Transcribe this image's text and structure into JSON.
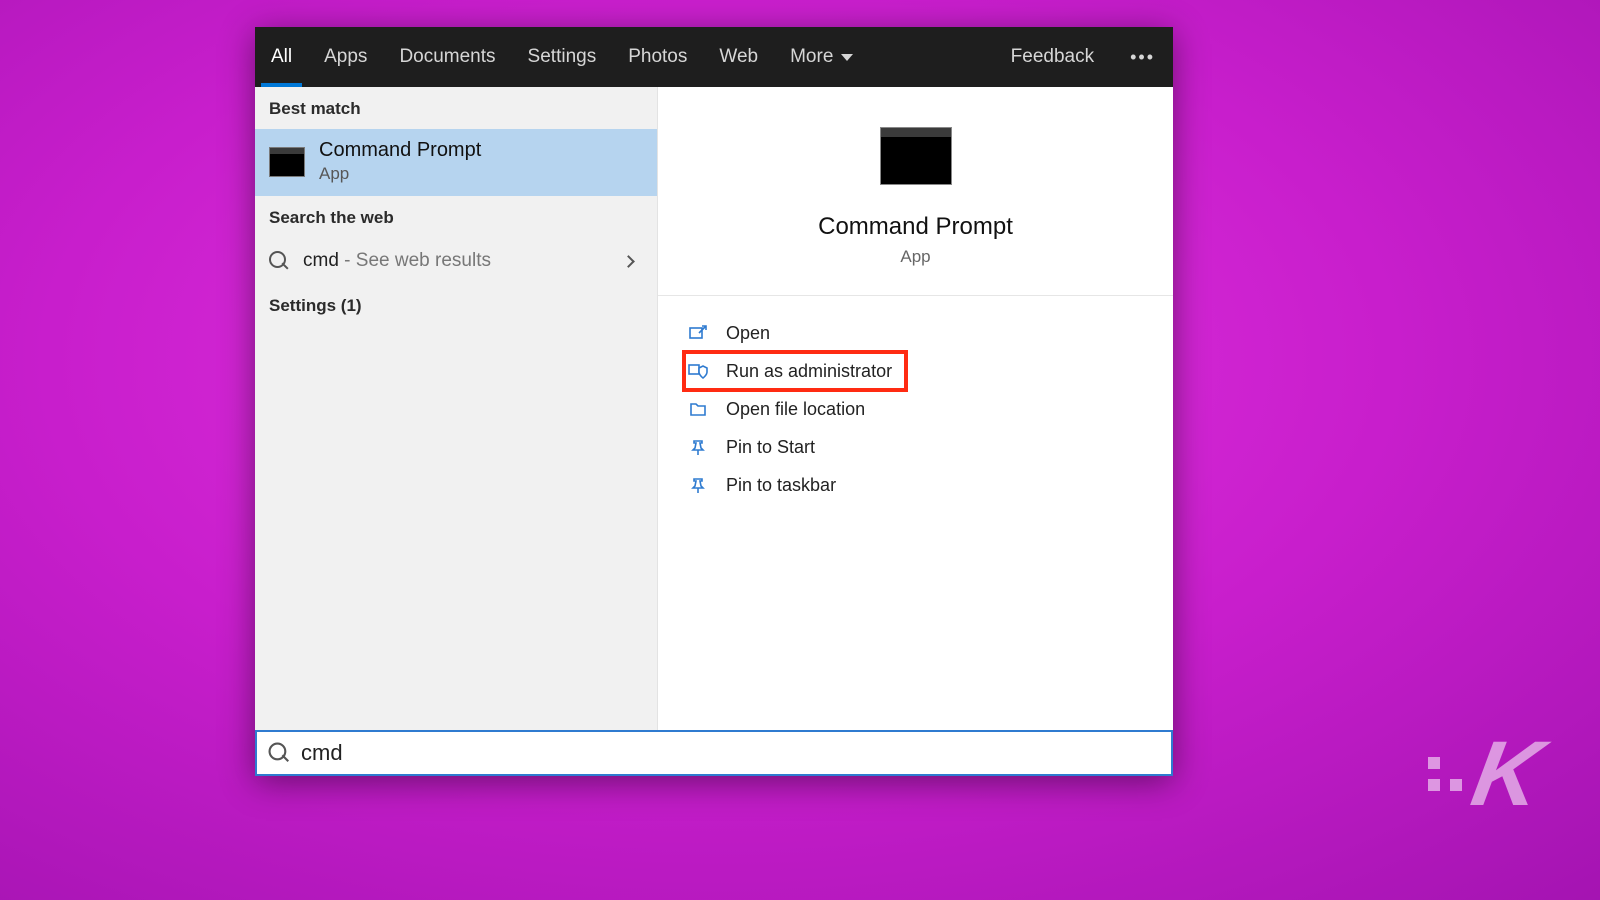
{
  "tabs": {
    "all": "All",
    "apps": "Apps",
    "documents": "Documents",
    "settings": "Settings",
    "photos": "Photos",
    "web": "Web",
    "more": "More"
  },
  "header": {
    "feedback": "Feedback"
  },
  "left": {
    "best_match_label": "Best match",
    "result": {
      "title": "Command Prompt",
      "sub": "App"
    },
    "search_web_label": "Search the web",
    "web_query": "cmd",
    "web_hint": " - See web results",
    "settings_label": "Settings (1)"
  },
  "preview": {
    "title": "Command Prompt",
    "sub": "App"
  },
  "actions": {
    "open": "Open",
    "run_admin": "Run as administrator",
    "open_location": "Open file location",
    "pin_start": "Pin to Start",
    "pin_taskbar": "Pin to taskbar"
  },
  "search": {
    "value": "cmd"
  },
  "watermark": {
    "letter": "K"
  }
}
